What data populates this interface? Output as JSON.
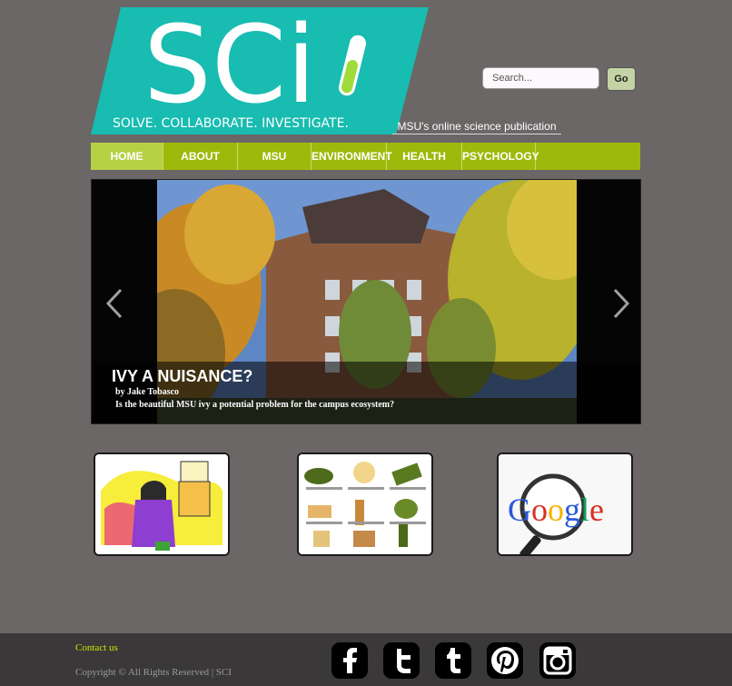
{
  "header": {
    "logo_text": "SCi",
    "logo_motto": "SOLVE. COLLABORATE. INVESTIGATE.",
    "tagline": "MSU's online science publication"
  },
  "search": {
    "placeholder": "Search...",
    "button_label": "Go"
  },
  "nav": {
    "items": [
      {
        "label": "HOME",
        "active": true
      },
      {
        "label": "ABOUT",
        "active": false
      },
      {
        "label": "MSU",
        "active": false
      },
      {
        "label": "ENVIRONMENT",
        "active": false
      },
      {
        "label": "HEALTH",
        "active": false
      },
      {
        "label": "PSYCHOLOGY",
        "active": false
      }
    ]
  },
  "slider": {
    "title": "IVY A NUISANCE?",
    "author": "by Jake Tobasco",
    "summary": "Is the beautiful MSU ivy a potential problem for the campus ecosystem?",
    "prev_icon": "chevron-left-icon",
    "next_icon": "chevron-right-icon"
  },
  "thumbnails": [
    {
      "image": "new-year-cartoon"
    },
    {
      "image": "champagne-infographic"
    },
    {
      "image": "google-magnifier",
      "text": "Google"
    }
  ],
  "footer": {
    "contact": "Contact us",
    "copyright": "Copyright © All Rights Reserved | SCI",
    "social": [
      "facebook-icon",
      "twitter-icon",
      "tumblr-icon",
      "pinterest-icon",
      "instagram-icon"
    ]
  },
  "colors": {
    "background": "#6a6766",
    "nav_green": "#9dba0c",
    "logo_teal": "#18bcb0",
    "footer": "#3a3838",
    "contact_link": "#c9e600"
  }
}
